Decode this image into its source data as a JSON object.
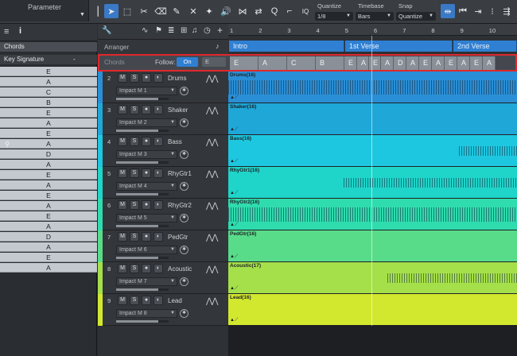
{
  "toolbar": {
    "parameter_label": "Parameter",
    "quantize_label": "Quantize",
    "quantize_value": "1/8",
    "timebase_label": "Timebase",
    "timebase_value": "Bars",
    "snap_label": "Snap",
    "snap_value": "Quantize",
    "iq_label": "IQ"
  },
  "left_panel": {
    "info_icon": "i",
    "chords_label": "Chords",
    "key_signature_label": "Key Signature",
    "key_signature_value": "-",
    "chords": [
      "E",
      "A",
      "C",
      "B",
      "E",
      "A",
      "E",
      "A",
      "D",
      "A",
      "E",
      "A",
      "E",
      "A",
      "E",
      "A",
      "D",
      "A",
      "E",
      "A"
    ]
  },
  "arranger": {
    "label": "Arranger",
    "sections": [
      {
        "name": "Intro"
      },
      {
        "name": "1st Verse"
      },
      {
        "name": "2nd Verse"
      }
    ],
    "ruler_ticks": [
      "1",
      "2",
      "3",
      "4",
      "5",
      "6",
      "7",
      "8",
      "9",
      "10"
    ]
  },
  "chord_track": {
    "label": "Chords",
    "follow_label": "Follow:",
    "follow_value": "On",
    "key_value": "E",
    "chords": [
      "E",
      "A",
      "C",
      "B",
      "E",
      "A",
      "E",
      "A",
      "D",
      "A",
      "E",
      "A",
      "E",
      "A",
      "E",
      "A"
    ]
  },
  "tracks": [
    {
      "num": "2",
      "name": "Drums",
      "instrument": "Impact M 1",
      "clip": "Drums(16)",
      "color": "#2a8fd6",
      "fader": 0.8,
      "activity": 1.0
    },
    {
      "num": "3",
      "name": "Shaker",
      "instrument": "Impact M 2",
      "clip": "Shaker(16)",
      "color": "#1fa7d8",
      "fader": 0.8,
      "activity": 0.0
    },
    {
      "num": "4",
      "name": "Bass",
      "instrument": "Impact M 3",
      "clip": "Bass(16)",
      "color": "#1ec7e0",
      "fader": 0.8,
      "activity": 0.2
    },
    {
      "num": "5",
      "name": "RhyGtr1",
      "instrument": "Impact M 4",
      "clip": "RhyGtr1(16)",
      "color": "#1fd5c9",
      "fader": 0.8,
      "activity": 0.6
    },
    {
      "num": "6",
      "name": "RhyGtr2",
      "instrument": "Impact M 5",
      "clip": "RhyGtr2(16)",
      "color": "#2fdcae",
      "fader": 0.8,
      "activity": 1.0
    },
    {
      "num": "7",
      "name": "PedGtr",
      "instrument": "Impact M 6",
      "clip": "PedGtr(16)",
      "color": "#58dc8a",
      "fader": 0.8,
      "activity": 0.0
    },
    {
      "num": "8",
      "name": "Acoustic",
      "instrument": "Impact M 7",
      "clip": "Acoustic(17)",
      "color": "#a5e04a",
      "fader": 0.8,
      "activity": 0.45
    },
    {
      "num": "9",
      "name": "Lead",
      "instrument": "Impact M 8",
      "clip": "Lead(16)",
      "color": "#d2e82e",
      "fader": 0.8,
      "activity": 0.0
    }
  ],
  "track_buttons": {
    "mute": "M",
    "solo": "S"
  }
}
